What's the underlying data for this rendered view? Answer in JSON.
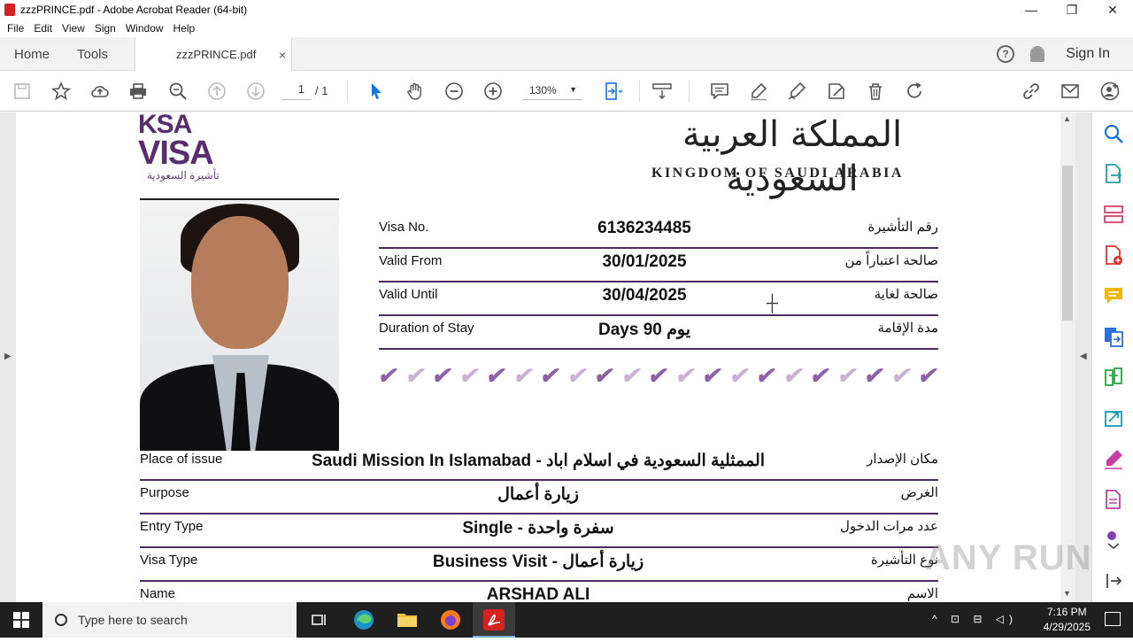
{
  "window": {
    "title": "zzzPRINCE.pdf - Adobe Acrobat Reader (64-bit)",
    "controls": [
      "—",
      "❐",
      "✕"
    ]
  },
  "menu": [
    "File",
    "Edit",
    "View",
    "Sign",
    "Window",
    "Help"
  ],
  "tabs": {
    "home": "Home",
    "tools": "Tools",
    "document": "zzzPRINCE.pdf",
    "close": "×",
    "help_icon_text": "?",
    "sign_in": "Sign In"
  },
  "toolbar": {
    "page_current": "1",
    "page_total": "/ 1",
    "zoom": "130%",
    "zoom_caret": "▼"
  },
  "document": {
    "logo": {
      "line1": "KSA",
      "line2": "VISA",
      "arabic": "تأشيرة السعودية"
    },
    "header": {
      "arabic": "المملكة العربية السعودية",
      "english": "KINGDOM OF SAUDI ARABIA"
    },
    "fields_top": [
      {
        "en": "Visa No.",
        "value": "6136234485",
        "ar": "رقم التأشيرة"
      },
      {
        "en": "Valid From",
        "value": "30/01/2025",
        "ar": "صالحة اعتباراً من"
      },
      {
        "en": "Valid Until",
        "value": "30/04/2025",
        "ar": "صالحة لغاية"
      },
      {
        "en": "Duration of Stay",
        "value": "Days 90 يوم",
        "ar": "مدة الإقامة"
      }
    ],
    "check_count": 21,
    "fields_bottom": [
      {
        "en": "Place of issue",
        "value": "Saudi Mission In Islamabad - الممثلية السعودية في اسلام اباد",
        "ar": "مكان الإصدار"
      },
      {
        "en": "Purpose",
        "value": "زيارة أعمال",
        "ar": "الغرض"
      },
      {
        "en": "Entry Type",
        "value": "Single - سفرة واحدة",
        "ar": "عدد مرات الدخول"
      },
      {
        "en": "Visa Type",
        "value": "Business Visit - زيارة أعمال",
        "ar": "نوع التأشيرة"
      },
      {
        "en": "Name",
        "value": "ARSHAD ALI",
        "ar": "الاسم"
      }
    ]
  },
  "watermark": "ANY RUN",
  "taskbar": {
    "search_placeholder": "Type here to search",
    "time": "7:16 PM",
    "date": "4/29/2025",
    "tray": "^ ⊡ ⊟ ◁)"
  },
  "colors": {
    "accent_purple": "#4a2c5e",
    "check_purple": "#8f62a8",
    "acrobat_red": "#d6211f",
    "toolbar_blue": "#1473e6"
  }
}
